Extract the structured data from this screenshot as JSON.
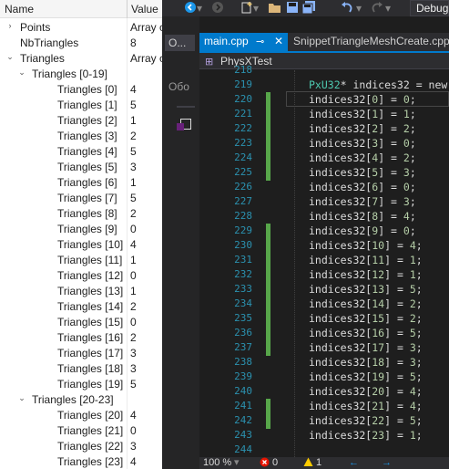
{
  "watch": {
    "col_name": "Name",
    "col_value": "Value",
    "rows": [
      {
        "toggle": "›",
        "name": "Points",
        "value": "Array c",
        "indent": 0
      },
      {
        "toggle": "",
        "name": "NbTriangles",
        "value": "8",
        "indent": 0
      },
      {
        "toggle": "⌄",
        "name": "Triangles",
        "value": "Array c",
        "indent": 0
      },
      {
        "toggle": "⌄",
        "name": "Triangles [0-19]",
        "value": "",
        "indent": 1
      },
      {
        "toggle": "",
        "name": "Triangles [0]",
        "value": "4",
        "indent": 2
      },
      {
        "toggle": "",
        "name": "Triangles [1]",
        "value": "5",
        "indent": 2
      },
      {
        "toggle": "",
        "name": "Triangles [2]",
        "value": "1",
        "indent": 2
      },
      {
        "toggle": "",
        "name": "Triangles [3]",
        "value": "2",
        "indent": 2
      },
      {
        "toggle": "",
        "name": "Triangles [4]",
        "value": "5",
        "indent": 2
      },
      {
        "toggle": "",
        "name": "Triangles [5]",
        "value": "3",
        "indent": 2
      },
      {
        "toggle": "",
        "name": "Triangles [6]",
        "value": "1",
        "indent": 2
      },
      {
        "toggle": "",
        "name": "Triangles [7]",
        "value": "5",
        "indent": 2
      },
      {
        "toggle": "",
        "name": "Triangles [8]",
        "value": "2",
        "indent": 2
      },
      {
        "toggle": "",
        "name": "Triangles [9]",
        "value": "0",
        "indent": 2
      },
      {
        "toggle": "",
        "name": "Triangles [10]",
        "value": "4",
        "indent": 2
      },
      {
        "toggle": "",
        "name": "Triangles [11]",
        "value": "1",
        "indent": 2
      },
      {
        "toggle": "",
        "name": "Triangles [12]",
        "value": "0",
        "indent": 2
      },
      {
        "toggle": "",
        "name": "Triangles [13]",
        "value": "1",
        "indent": 2
      },
      {
        "toggle": "",
        "name": "Triangles [14]",
        "value": "2",
        "indent": 2
      },
      {
        "toggle": "",
        "name": "Triangles [15]",
        "value": "0",
        "indent": 2
      },
      {
        "toggle": "",
        "name": "Triangles [16]",
        "value": "2",
        "indent": 2
      },
      {
        "toggle": "",
        "name": "Triangles [17]",
        "value": "3",
        "indent": 2
      },
      {
        "toggle": "",
        "name": "Triangles [18]",
        "value": "3",
        "indent": 2
      },
      {
        "toggle": "",
        "name": "Triangles [19]",
        "value": "5",
        "indent": 2
      },
      {
        "toggle": "⌄",
        "name": "Triangles [20-23]",
        "value": "",
        "indent": 1
      },
      {
        "toggle": "",
        "name": "Triangles [20]",
        "value": "4",
        "indent": 2
      },
      {
        "toggle": "",
        "name": "Triangles [21]",
        "value": "0",
        "indent": 2
      },
      {
        "toggle": "",
        "name": "Triangles [22]",
        "value": "3",
        "indent": 2
      },
      {
        "toggle": "",
        "name": "Triangles [23]",
        "value": "4",
        "indent": 2
      }
    ]
  },
  "toolbar": {
    "icons": [
      "back-arrow-icon",
      "forward-arrow-icon",
      "new-item-icon",
      "open-folder-icon",
      "save-icon",
      "save-all-icon",
      "undo-icon",
      "redo-icon"
    ],
    "config_label": "Debug"
  },
  "side_panel": {
    "tab_label": "O...",
    "other_label": "Обо"
  },
  "tabs": {
    "active": "main.cpp",
    "other": "SnippetTriangleMeshCreate.cpp"
  },
  "navbar": {
    "project": "PhysXTest"
  },
  "code": [
    {
      "num": "218",
      "type": "text",
      "text": "",
      "changed": false
    },
    {
      "num": "219",
      "type": "decl",
      "type_name": "PxU32",
      "rest": "* indices32 = new",
      "changed": false
    },
    {
      "num": "220",
      "type": "assign",
      "idx": "0",
      "val": "0",
      "changed": true
    },
    {
      "num": "221",
      "type": "assign",
      "idx": "1",
      "val": "1",
      "changed": true
    },
    {
      "num": "222",
      "type": "assign",
      "idx": "2",
      "val": "2",
      "changed": true
    },
    {
      "num": "223",
      "type": "assign",
      "idx": "3",
      "val": "0",
      "changed": true
    },
    {
      "num": "224",
      "type": "assign",
      "idx": "4",
      "val": "2",
      "changed": true
    },
    {
      "num": "225",
      "type": "assign",
      "idx": "5",
      "val": "3",
      "changed": true
    },
    {
      "num": "226",
      "type": "assign",
      "idx": "6",
      "val": "0",
      "changed": false
    },
    {
      "num": "227",
      "type": "assign",
      "idx": "7",
      "val": "3",
      "changed": false
    },
    {
      "num": "228",
      "type": "assign",
      "idx": "8",
      "val": "4",
      "changed": false
    },
    {
      "num": "229",
      "type": "assign",
      "idx": "9",
      "val": "0",
      "changed": true
    },
    {
      "num": "230",
      "type": "assign",
      "idx": "10",
      "val": "4",
      "changed": true
    },
    {
      "num": "231",
      "type": "assign",
      "idx": "11",
      "val": "1",
      "changed": true
    },
    {
      "num": "232",
      "type": "assign",
      "idx": "12",
      "val": "1",
      "changed": true
    },
    {
      "num": "233",
      "type": "assign",
      "idx": "13",
      "val": "5",
      "changed": true
    },
    {
      "num": "234",
      "type": "assign",
      "idx": "14",
      "val": "2",
      "changed": true
    },
    {
      "num": "235",
      "type": "assign",
      "idx": "15",
      "val": "2",
      "changed": true
    },
    {
      "num": "236",
      "type": "assign",
      "idx": "16",
      "val": "5",
      "changed": true
    },
    {
      "num": "237",
      "type": "assign",
      "idx": "17",
      "val": "3",
      "changed": true
    },
    {
      "num": "238",
      "type": "assign",
      "idx": "18",
      "val": "3",
      "changed": false
    },
    {
      "num": "239",
      "type": "assign",
      "idx": "19",
      "val": "5",
      "changed": false
    },
    {
      "num": "240",
      "type": "assign",
      "idx": "20",
      "val": "4",
      "changed": false
    },
    {
      "num": "241",
      "type": "assign",
      "idx": "21",
      "val": "4",
      "changed": true
    },
    {
      "num": "242",
      "type": "assign",
      "idx": "22",
      "val": "5",
      "changed": true
    },
    {
      "num": "243",
      "type": "assign",
      "idx": "23",
      "val": "1",
      "changed": false
    },
    {
      "num": "244",
      "type": "text",
      "text": "",
      "changed": false
    }
  ],
  "status": {
    "zoom": "100 %",
    "errors": "0",
    "warnings": "1",
    "colors": {
      "error": "#e51400",
      "warning": "#ffcc00",
      "changed": "#57a64a",
      "accent": "#007acc"
    }
  }
}
